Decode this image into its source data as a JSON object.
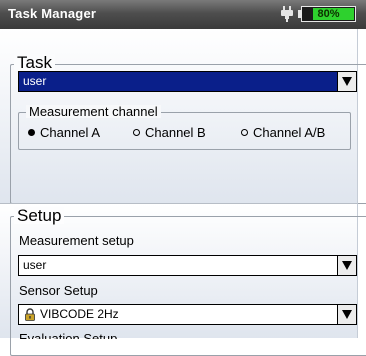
{
  "window": {
    "title": "Task Manager",
    "battery_percent": "80%",
    "battery_level": 0.8,
    "battery_color": "#2ed12e",
    "power_icon": "plug-icon"
  },
  "task": {
    "group_title": "Task",
    "selected_value": "user",
    "measurement_channel": {
      "group_title": "Measurement channel",
      "options": [
        {
          "label": "Channel A",
          "selected": true
        },
        {
          "label": "Channel B",
          "selected": false
        },
        {
          "label": "Channel A/B",
          "selected": false
        }
      ]
    }
  },
  "setup": {
    "group_title": "Setup",
    "measurement_setup": {
      "label": "Measurement setup",
      "value": "user"
    },
    "sensor_setup": {
      "label": "Sensor Setup",
      "value": "VIBCODE 2Hz",
      "icon": "lock-icon"
    },
    "next_label": "Evaluation Setup"
  },
  "colors": {
    "selection": "#0a1f8a",
    "titlebar": "#4e4e4e"
  }
}
